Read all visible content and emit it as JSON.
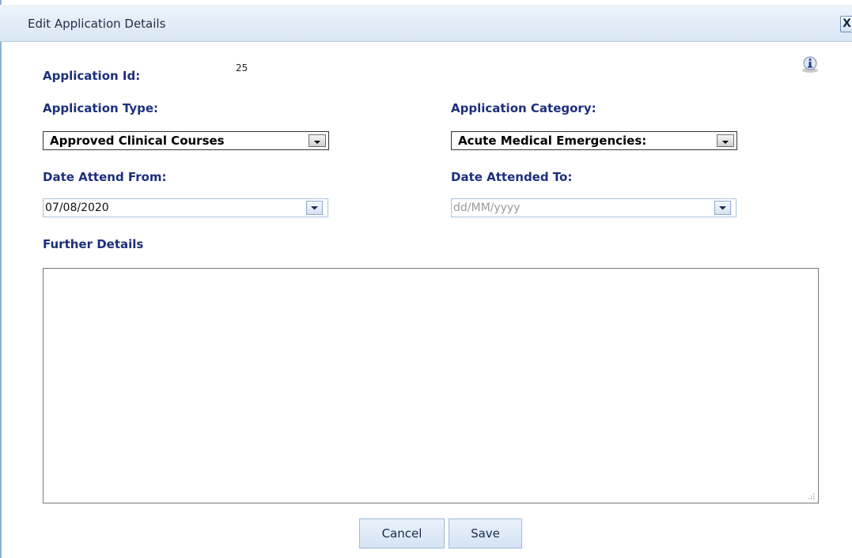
{
  "dialog": {
    "title": "Edit Application Details",
    "close_label": "X"
  },
  "form": {
    "application_id_label": "Application Id:",
    "application_id_value": "25",
    "application_type_label": "Application Type:",
    "application_type_value": "Approved Clinical Courses",
    "application_category_label": "Application Category:",
    "application_category_value": "Acute Medical Emergencies:",
    "date_from_label": "Date Attend From:",
    "date_from_value": "07/08/2020",
    "date_to_label": "Date Attended To:",
    "date_to_placeholder": "dd/MM/yyyy",
    "further_details_label": "Further Details",
    "further_details_value": ""
  },
  "buttons": {
    "cancel_label": "Cancel",
    "save_label": "Save"
  },
  "icons": {
    "info": "info-icon",
    "close": "close-icon",
    "dropdown": "chevron-down-icon",
    "calendar_dropdown": "chevron-down-icon"
  },
  "colors": {
    "label": "#1d2f7c",
    "titlebar": "#dce8f5",
    "button": "#dbe7f5"
  }
}
